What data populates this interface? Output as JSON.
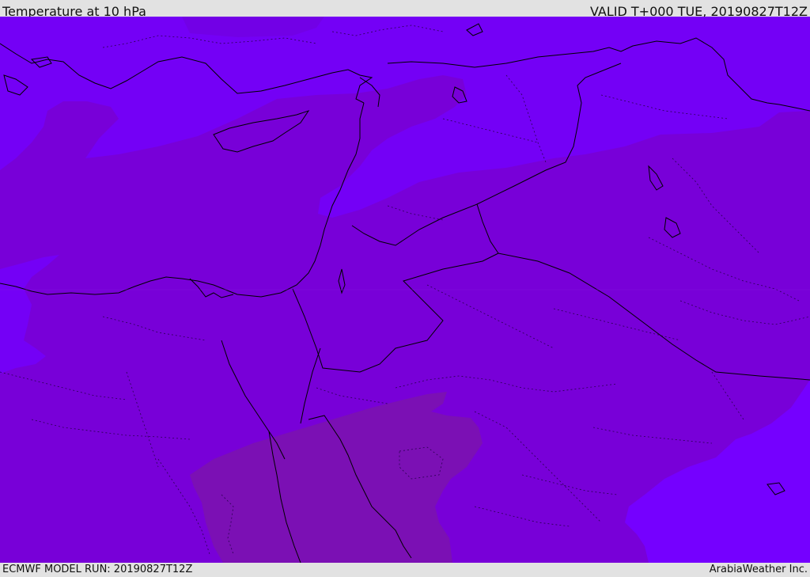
{
  "header": {
    "title": "Temperature at 10 hPa",
    "valid_time": "VALID T+000 TUE, 20190827T12Z"
  },
  "footer": {
    "model_run": "ECMWF MODEL RUN: 20190827T12Z",
    "credit": "ArabiaWeather Inc."
  },
  "map": {
    "variable": "temperature",
    "pressure_level": "10 hPa",
    "colors": {
      "warmest_band": "#7b10b4",
      "mid_band": "#7800d8",
      "cool_band": "#7400f6",
      "coolest_band": "#7500ff",
      "coastline": "#000000",
      "border_dotted": "#2a0050"
    }
  }
}
